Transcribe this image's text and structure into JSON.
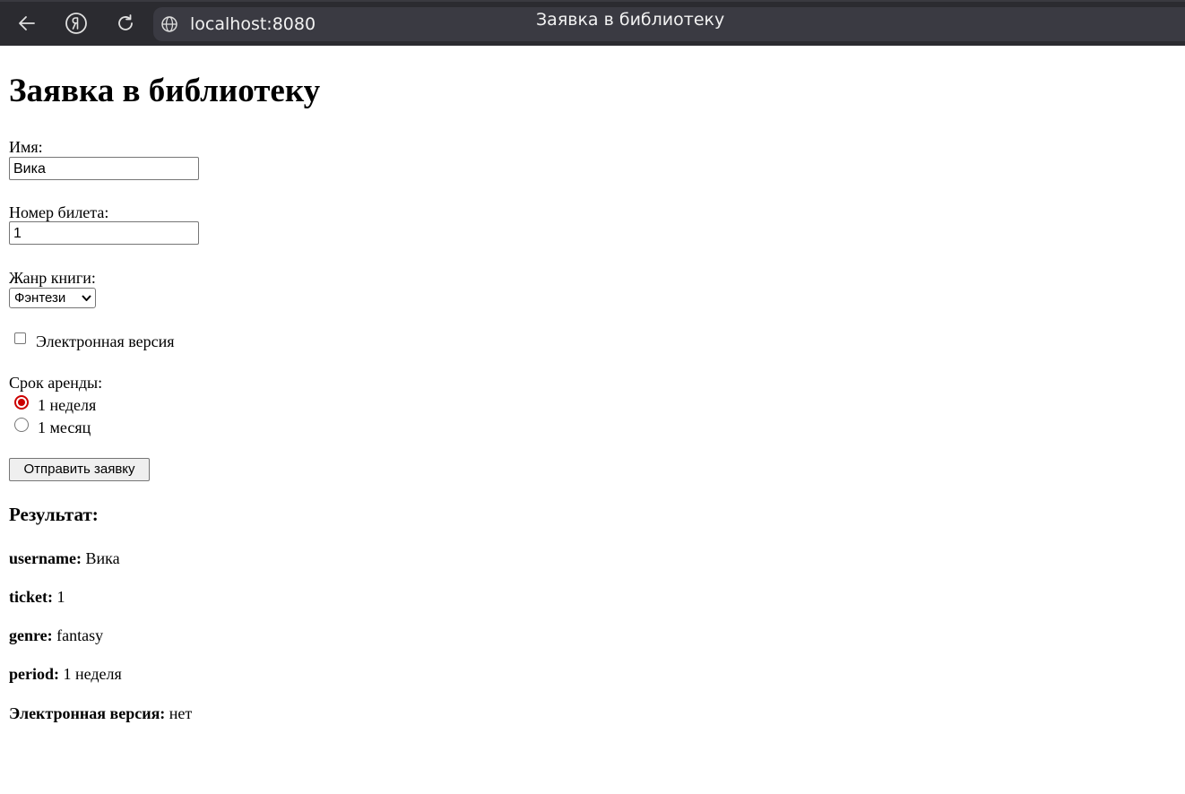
{
  "browser": {
    "url": "localhost:8080",
    "tab_title": "Заявка в библиотеку"
  },
  "page": {
    "heading": "Заявка в библиотеку",
    "form": {
      "name_label": "Имя:",
      "name_value": "Вика",
      "ticket_label": "Номер билета:",
      "ticket_value": "1",
      "genre_label": "Жанр книги:",
      "genre_selected": "Фэнтези",
      "ebook_label": "Электронная версия",
      "ebook_checked": false,
      "period_label": "Срок аренды:",
      "period_options": [
        {
          "label": "1 неделя",
          "checked": true
        },
        {
          "label": "1 месяц",
          "checked": false
        }
      ],
      "submit_label": "Отправить заявку"
    },
    "result": {
      "heading": "Результат:",
      "rows": [
        {
          "key": "username:",
          "value": "Вика"
        },
        {
          "key": "ticket:",
          "value": "1"
        },
        {
          "key": "genre:",
          "value": "fantasy"
        },
        {
          "key": "period:",
          "value": "1 неделя"
        },
        {
          "key": "Электронная версия:",
          "value": "нет"
        }
      ]
    }
  },
  "colors": {
    "toolbar_bg": "#2b2b30",
    "address_bg": "#3a3a42",
    "radio_accent": "#cc0000"
  },
  "icons": [
    "back-arrow-icon",
    "yandex-logo-icon",
    "reload-icon",
    "globe-icon",
    "select-chevron-icon"
  ]
}
